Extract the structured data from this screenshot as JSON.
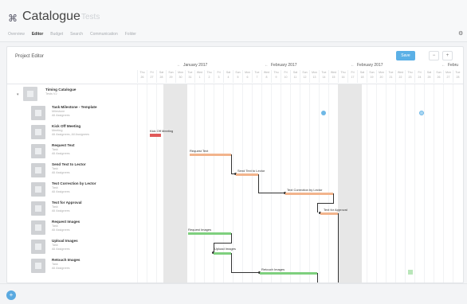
{
  "header": {
    "app_title": "Catalogue",
    "app_subtitle": "Tests",
    "nav": [
      {
        "label": "Overview",
        "active": false
      },
      {
        "label": "Editor",
        "active": true
      },
      {
        "label": "Budget",
        "active": false
      },
      {
        "label": "Search",
        "active": false
      },
      {
        "label": "Communication",
        "active": false
      },
      {
        "label": "Folder",
        "active": false
      }
    ]
  },
  "editor": {
    "title": "Project Editor",
    "save_label": "Save"
  },
  "timeline": {
    "months": [
      {
        "prev": "←",
        "label": "January 2017"
      },
      {
        "prev": "←",
        "label": "February 2017"
      },
      {
        "prev": "←",
        "label": "February 2017"
      },
      {
        "prev": "←",
        "label": "Febru"
      }
    ],
    "days": [
      {
        "w": "Thu",
        "d": "26"
      },
      {
        "w": "Fri",
        "d": "27"
      },
      {
        "w": "Sat",
        "d": "28"
      },
      {
        "w": "Sun",
        "d": "29"
      },
      {
        "w": "Mon",
        "d": "30"
      },
      {
        "w": "Tue",
        "d": "31"
      },
      {
        "w": "Wed",
        "d": "1"
      },
      {
        "w": "Thu",
        "d": "2"
      },
      {
        "w": "Fri",
        "d": "3"
      },
      {
        "w": "Sat",
        "d": "4"
      },
      {
        "w": "Sun",
        "d": "5"
      },
      {
        "w": "Mon",
        "d": "6"
      },
      {
        "w": "Tue",
        "d": "7"
      },
      {
        "w": "Wed",
        "d": "8"
      },
      {
        "w": "Thu",
        "d": "9"
      },
      {
        "w": "Fri",
        "d": "10"
      },
      {
        "w": "Sat",
        "d": "11"
      },
      {
        "w": "Sun",
        "d": "12"
      },
      {
        "w": "Mon",
        "d": "13"
      },
      {
        "w": "Tue",
        "d": "14"
      },
      {
        "w": "Wed",
        "d": "15"
      },
      {
        "w": "Thu",
        "d": "16"
      },
      {
        "w": "Fri",
        "d": "17"
      },
      {
        "w": "Sat",
        "d": "18"
      },
      {
        "w": "Sun",
        "d": "19"
      },
      {
        "w": "Mon",
        "d": "20"
      },
      {
        "w": "Tue",
        "d": "21"
      },
      {
        "w": "Wed",
        "d": "22"
      },
      {
        "w": "Thu",
        "d": "23"
      },
      {
        "w": "Fri",
        "d": "24"
      },
      {
        "w": "Sat",
        "d": "25"
      },
      {
        "w": "Sun",
        "d": "26"
      },
      {
        "w": "Mon",
        "d": "27"
      },
      {
        "w": "Tue",
        "d": "28"
      }
    ]
  },
  "tasks": [
    {
      "name": "Timing Catalogue",
      "meta1": "Tests V2",
      "meta2": "",
      "bar_label": ""
    },
    {
      "name": "Task Milestone - Template",
      "meta1": "Milestone",
      "meta2": "All Assignees",
      "bar_label": ""
    },
    {
      "name": "Kick Off Meeting",
      "meta1": "Meeting",
      "meta2": "All Assignees, All Assignees",
      "bar_label": "Kick Off Meeting"
    },
    {
      "name": "Request Text",
      "meta1": "Task",
      "meta2": "All Assignees",
      "bar_label": "Request Text"
    },
    {
      "name": "Send Text to Lector",
      "meta1": "Task",
      "meta2": "All Assignees",
      "bar_label": "Send Text to Lector"
    },
    {
      "name": "Text Correction by Lector",
      "meta1": "Task",
      "meta2": "All Assignees",
      "bar_label": "Text Correction by Lector"
    },
    {
      "name": "Text for Approval",
      "meta1": "Task",
      "meta2": "All Assignees",
      "bar_label": "Text for Approval"
    },
    {
      "name": "Request Images",
      "meta1": "Task",
      "meta2": "All Assignees",
      "bar_label": "Request Images"
    },
    {
      "name": "Upload Images",
      "meta1": "Task",
      "meta2": "All Assignees",
      "bar_label": "Upload Images"
    },
    {
      "name": "Retouch Images",
      "meta1": "Task",
      "meta2": "All Assignees",
      "bar_label": "Retouch Images"
    }
  ],
  "colors": {
    "accent": "#5bb0e6",
    "bar_red": "#e05a5a",
    "bar_orange": "#f2b48c",
    "bar_green": "#7ed07e",
    "milestone": "#6fb8e6",
    "weekend": "#e7e7e7"
  },
  "icons": {
    "logo": "hierarchy-icon",
    "settings": "gear-icon",
    "fab": "plus-icon"
  }
}
